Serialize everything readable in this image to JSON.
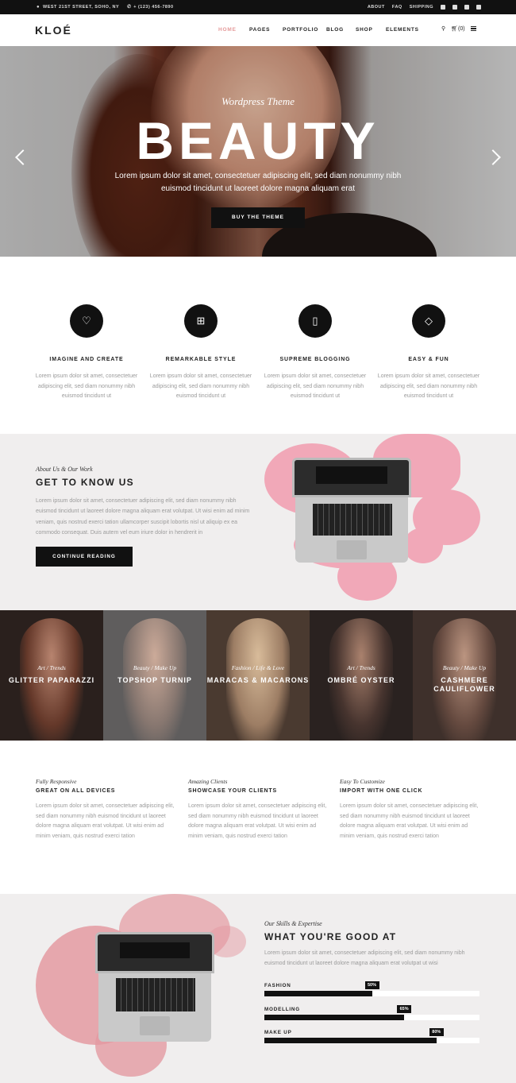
{
  "topbar": {
    "address": "WEST 21ST STREET, SOHO, NY",
    "phone": "+ (123) 456-7890",
    "links": [
      "ABOUT",
      "FAQ",
      "SHIPPING"
    ],
    "social_icons": [
      "facebook-icon",
      "twitter-icon",
      "pinterest-icon",
      "instagram-icon"
    ]
  },
  "nav": {
    "logo": "KLOÉ",
    "menu": [
      "HOME",
      "PAGES",
      "PORTFOLIO",
      "BLOG",
      "SHOP",
      "ELEMENTS"
    ],
    "active": "HOME",
    "cart": "(0)",
    "accent_color": "#e59a9a"
  },
  "hero": {
    "subtitle": "Wordpress Theme",
    "title": "BEAUTY",
    "text": "Lorem ipsum dolor sit amet, consectetuer adipiscing elit, sed diam nonummy nibh euismod tincidunt ut laoreet dolore magna aliquam erat",
    "button": "BUY THE THEME"
  },
  "features": [
    {
      "icon": "heart-icon",
      "title": "IMAGINE AND CREATE",
      "text": "Lorem ipsum dolor sit amet, consectetuer adipiscing elit, sed diam nonummy nibh euismod tincidunt ut"
    },
    {
      "icon": "gift-icon",
      "title": "REMARKABLE STYLE",
      "text": "Lorem ipsum dolor sit amet, consectetuer adipiscing elit, sed diam nonummy nibh euismod tincidunt ut"
    },
    {
      "icon": "clipboard-icon",
      "title": "SUPREME BLOGGING",
      "text": "Lorem ipsum dolor sit amet, consectetuer adipiscing elit, sed diam nonummy nibh euismod tincidunt ut"
    },
    {
      "icon": "tag-icon",
      "title": "EASY & FUN",
      "text": "Lorem ipsum dolor sit amet, consectetuer adipiscing elit, sed diam nonummy nibh euismod tincidunt ut"
    }
  ],
  "about": {
    "kicker": "About Us & Our Work",
    "title": "GET TO KNOW US",
    "text": "Lorem ipsum dolor sit amet, consectetuer adipiscing elit, sed diam nonummy nibh euismod tincidunt ut laoreet dolore magna aliquam erat volutpat. Ut wisi enim ad minim veniam, quis nostrud exerci tation ullamcorper suscipit lobortis nisl ut aliquip ex ea commodo consequat. Duis autem vel eum iriure dolor in hendrerit in",
    "button": "CONTINUE READING"
  },
  "portfolio": [
    {
      "category": "Art / Trends",
      "title": "GLITTER PAPARAZZI",
      "color": "#3b2a26"
    },
    {
      "category": "Beauty / Make Up",
      "title": "TOPSHOP TURNIP",
      "color": "#6f6c6c"
    },
    {
      "category": "Fashion / Life & Love",
      "title": "MARACAS & MACARONS",
      "color": "#5d4a3c"
    },
    {
      "category": "Art / Trends",
      "title": "OMBRÉ OYSTER",
      "color": "#2c2422"
    },
    {
      "category": "Beauty / Make Up",
      "title": "CASHMERE CAULIFLOWER",
      "color": "#4a3a34"
    }
  ],
  "info": [
    {
      "kicker": "Fully Responsive",
      "title": "GREAT ON ALL DEVICES",
      "text": "Lorem ipsum dolor sit amet, consectetuer adipiscing elit, sed diam nonummy nibh euismod tincidunt ut laoreet dolore magna aliquam erat volutpat. Ut wisi enim ad minim veniam, quis nostrud exerci tation"
    },
    {
      "kicker": "Amazing Clients",
      "title": "SHOWCASE YOUR CLIENTS",
      "text": "Lorem ipsum dolor sit amet, consectetuer adipiscing elit, sed diam nonummy nibh euismod tincidunt ut laoreet dolore magna aliquam erat volutpat. Ut wisi enim ad minim veniam, quis nostrud exerci tation"
    },
    {
      "kicker": "Easy To Customize",
      "title": "IMPORT WITH ONE CLICK",
      "text": "Lorem ipsum dolor sit amet, consectetuer adipiscing elit, sed diam nonummy nibh euismod tincidunt ut laoreet dolore magna aliquam erat volutpat. Ut wisi enim ad minim veniam, quis nostrud exerci tation"
    }
  ],
  "skills": {
    "kicker": "Our Skills & Expertise",
    "title": "WHAT YOU'RE GOOD AT",
    "text": "Lorem ipsum dolor sit amet, consectetuer adipiscing elit, sed diam nonummy nibh euismod tincidunt ut laoreet dolore magna aliquam erat volutpat ut wisi",
    "bars": [
      {
        "label": "FASHION",
        "value": 50,
        "text": "50%"
      },
      {
        "label": "MODELLING",
        "value": 65,
        "text": "65%"
      },
      {
        "label": "MAKE UP",
        "value": 80,
        "text": "80%"
      }
    ]
  }
}
